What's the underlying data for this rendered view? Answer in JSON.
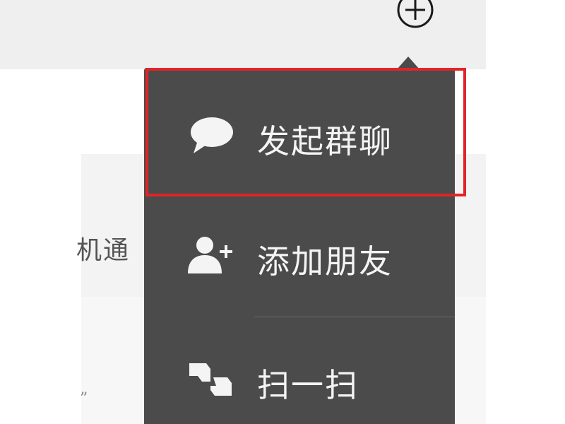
{
  "background": {
    "partial_contact_text": "机通",
    "partial_quote": "”"
  },
  "toolbar": {
    "plus_icon": "plus-circle-icon"
  },
  "popup_menu": {
    "items": [
      {
        "label": "发起群聊",
        "icon": "chat-bubble-icon"
      },
      {
        "label": "添加朋友",
        "icon": "add-user-icon"
      },
      {
        "label": "扫一扫",
        "icon": "scan-icon"
      }
    ]
  },
  "colors": {
    "menu_background": "#4b4b4b",
    "menu_text": "#f4f4f4",
    "highlight": "#e0242a",
    "header_background": "#efefef"
  }
}
